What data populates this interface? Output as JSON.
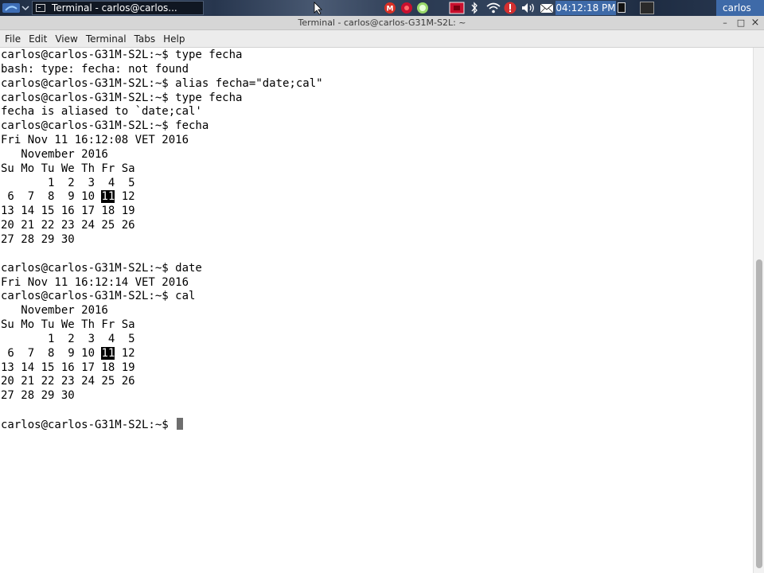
{
  "panel": {
    "task_label": "Terminal - carlos@carlos...",
    "clock": "04:12:18 PM",
    "user": "carlos",
    "icons": [
      "menu-icon",
      "gmail-icon",
      "record-icon",
      "chat-icon",
      "screen-record-icon",
      "bluetooth-icon",
      "wifi-icon",
      "alert-icon",
      "volume-icon",
      "mail-icon",
      "show-desktop-icon",
      "terminal-launcher-icon"
    ],
    "colors": {
      "panel_bg": "#23324a",
      "clock_bg": "#3e6aa8"
    }
  },
  "window": {
    "title": "Terminal - carlos@carlos-G31M-S2L: ~",
    "buttons": {
      "minimize": "–",
      "maximize": "□",
      "close": "×"
    }
  },
  "menubar": {
    "items": [
      "File",
      "Edit",
      "View",
      "Terminal",
      "Tabs",
      "Help"
    ]
  },
  "terminal": {
    "lines": [
      "carlos@carlos-G31M-S2L:~$ type fecha",
      "bash: type: fecha: not found",
      "carlos@carlos-G31M-S2L:~$ alias fecha=\"date;cal\"",
      "carlos@carlos-G31M-S2L:~$ type fecha",
      "fecha is aliased to `date;cal'",
      "carlos@carlos-G31M-S2L:~$ fecha",
      "Fri Nov 11 16:12:08 VET 2016",
      "   November 2016",
      "Su Mo Tu We Th Fr Sa",
      "       1  2  3  4  5",
      " 6  7  8  9 10 11 12",
      "13 14 15 16 17 18 19",
      "20 21 22 23 24 25 26",
      "27 28 29 30",
      "",
      "carlos@carlos-G31M-S2L:~$ date",
      "Fri Nov 11 16:12:14 VET 2016",
      "carlos@carlos-G31M-S2L:~$ cal",
      "   November 2016",
      "Su Mo Tu We Th Fr Sa",
      "       1  2  3  4  5",
      " 6  7  8  9 10 11 12",
      "13 14 15 16 17 18 19",
      "20 21 22 23 24 25 26",
      "27 28 29 30",
      "",
      "carlos@carlos-G31M-S2L:~$ "
    ],
    "highlight": "11",
    "highlight_lines": [
      10,
      21
    ],
    "cursor_line": 26,
    "colors": {
      "bg": "#ffffff",
      "fg": "#000000",
      "highlight_bg": "#000000",
      "highlight_fg": "#ffffff",
      "cursor": "#6e6e6e"
    }
  }
}
